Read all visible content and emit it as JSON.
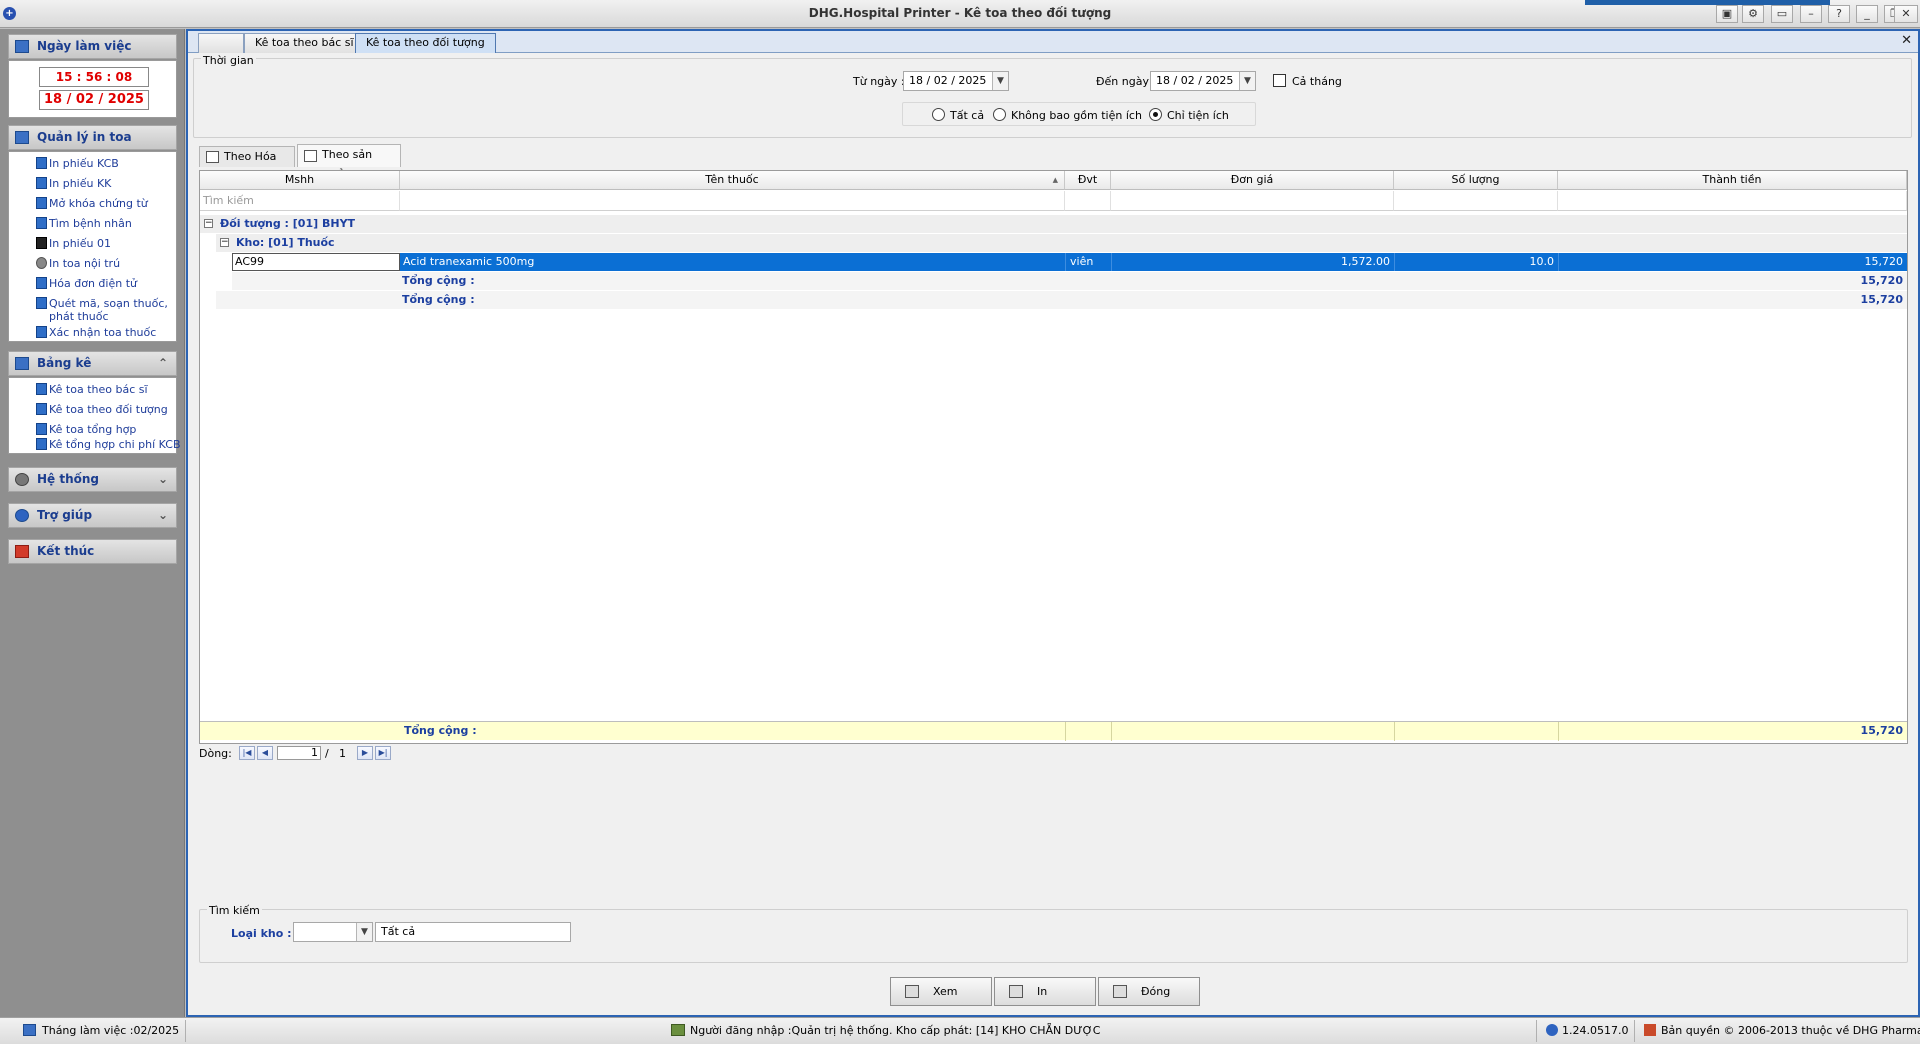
{
  "window": {
    "title": "DHG.Hospital Printer - Kê toa theo đối tượng",
    "app_icon": "+"
  },
  "sidebar": {
    "workday": {
      "title": "Ngày làm việc",
      "time": "15 : 56 : 08",
      "date": "18 / 02 / 2025"
    },
    "print_mgmt": {
      "title": "Quản lý in toa",
      "items": [
        "In phiếu KCB",
        "In phiếu KK",
        "Mở khóa chứng từ",
        "Tìm bệnh nhân",
        "In phiếu 01",
        "In toa nội trú",
        "Hóa đơn điện tử",
        "Quét mã, soạn thuốc, phát thuốc",
        "Xác nhận toa thuốc"
      ]
    },
    "report": {
      "title": "Bảng kê",
      "items": [
        "Kê toa theo bác sĩ",
        "Kê toa theo đối tượng",
        "Kê toa tổng hợp",
        "Kê tổng hợp chi phí KCB"
      ]
    },
    "system": {
      "title": "Hệ thống"
    },
    "help": {
      "title": "Trợ giúp"
    },
    "exit": {
      "title": "Kết thúc"
    }
  },
  "tabs": [
    "Kê toa theo bác sĩ",
    "Kê toa theo đối tượng"
  ],
  "filter": {
    "group_title": "Thời gian",
    "from_label": "Từ ngày :",
    "from_value": "18 / 02 / 2025",
    "to_label": "Đến ngày :",
    "to_value": "18 / 02 / 2025",
    "whole_month": "Cả tháng",
    "radio_all": "Tất cả",
    "radio_exclude": "Không bao gồm tiện ích",
    "radio_only": "Chỉ tiện ích"
  },
  "subtabs": [
    "Theo Hóa đơn",
    "Theo sản phẩm"
  ],
  "grid": {
    "columns": [
      "Mshh",
      "Tên thuốc",
      "Đvt",
      "Đơn giá",
      "Số lượng",
      "Thành tiền"
    ],
    "search_placeholder": "Tìm kiếm",
    "group1": "Đối tượng : [01] BHYT",
    "group2": "Kho:  [01] Thuốc",
    "row": {
      "code": "AC99",
      "name": "Acid tranexamic 500mg",
      "unit": "viên",
      "price": "1,572.00",
      "qty": "10.0",
      "total": "15,720"
    },
    "subtotal_label": "Tổng cộng :",
    "subtotal_value": "15,720",
    "total_label": "Tổng cộng :",
    "total_value": "15,720",
    "footer_label": "Tổng cộng :",
    "footer_value": "15,720"
  },
  "pager": {
    "label": "Dòng:",
    "current": "1",
    "sep": "/",
    "total": "1"
  },
  "search": {
    "title": "Tìm kiếm",
    "loai_kho_label": "Loại kho :",
    "loai_kho_value": "",
    "text_value": "Tất cả"
  },
  "buttons": {
    "view": "Xem",
    "print": "In",
    "close": "Đóng"
  },
  "status": {
    "month": "Tháng làm việc :02/2025",
    "user": "Người đăng nhập :Quản trị hệ thống. Kho cấp phát: [14] KHO CHẴN DƯỢC",
    "version": "1.24.0517.0",
    "copyright": "Bản quyền © 2006-2013 thuộc về DHG Pharma"
  }
}
